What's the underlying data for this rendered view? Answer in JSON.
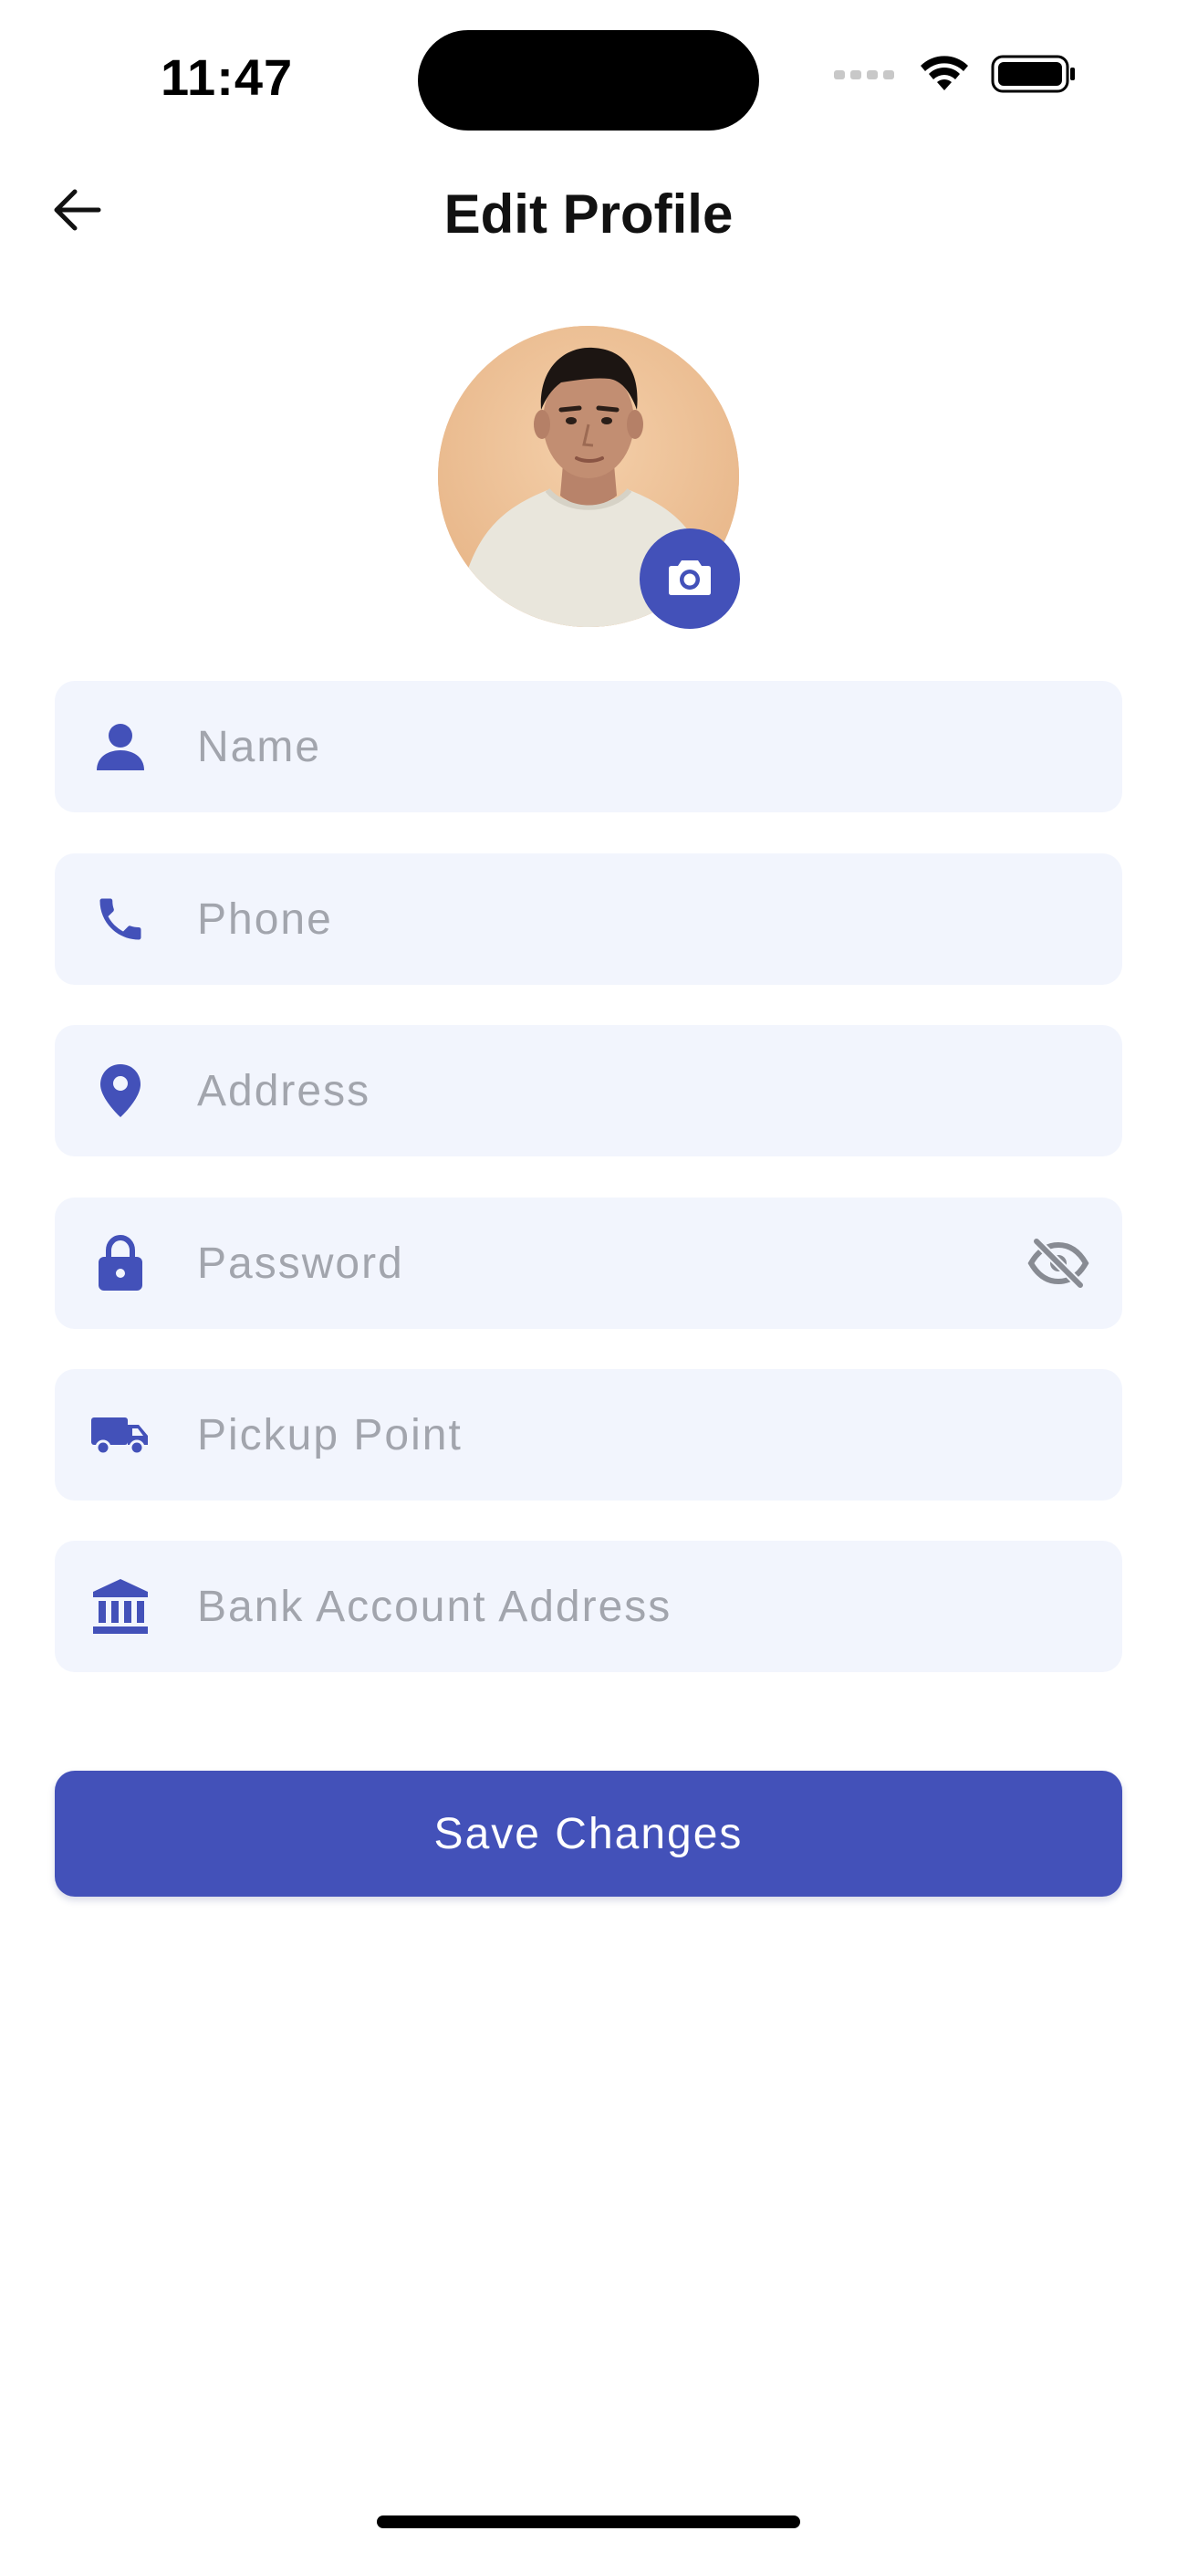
{
  "status_bar": {
    "time": "11:47"
  },
  "header": {
    "title": "Edit Profile",
    "back_icon": "arrow-left-icon"
  },
  "avatar": {
    "camera_icon": "camera-icon"
  },
  "form": {
    "fields": [
      {
        "icon": "person-icon",
        "placeholder": "Name",
        "value": ""
      },
      {
        "icon": "phone-icon",
        "placeholder": "Phone",
        "value": ""
      },
      {
        "icon": "location-pin-icon",
        "placeholder": "Address",
        "value": ""
      },
      {
        "icon": "lock-icon",
        "placeholder": "Password",
        "value": "",
        "toggle_icon": "eye-off-icon"
      },
      {
        "icon": "truck-icon",
        "placeholder": "Pickup Point",
        "value": ""
      },
      {
        "icon": "bank-icon",
        "placeholder": "Bank Account Address",
        "value": ""
      }
    ]
  },
  "save_button": {
    "label": "Save Changes"
  },
  "colors": {
    "accent": "#4351b9",
    "field_bg": "#f2f5fd",
    "placeholder": "#a2a5ad"
  }
}
